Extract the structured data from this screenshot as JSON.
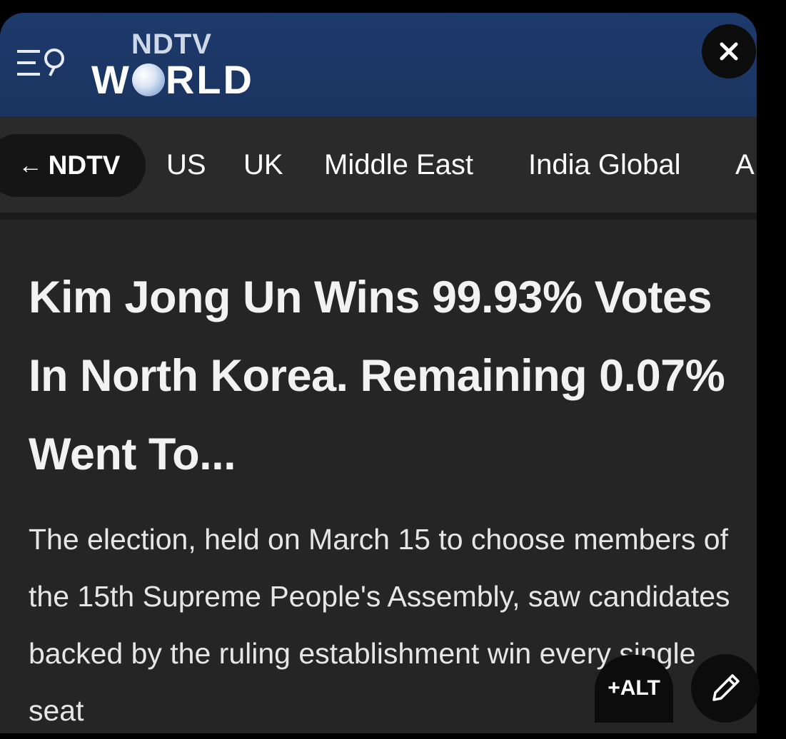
{
  "header": {
    "logo_top": "NDTV",
    "logo_world_pre": "W",
    "logo_world_post": "RLD",
    "brand_color": "#1d3a6c",
    "menu_icon": "menu-search-icon",
    "close_icon": "close-icon"
  },
  "nav": {
    "back_label": "NDTV",
    "items": [
      "US",
      "UK",
      "Middle East",
      "India Global",
      "A"
    ]
  },
  "article": {
    "headline": "Kim Jong Un Wins 99.93% Votes In North Korea. Remaining 0.07% Went To...",
    "body": "The election, held on March 15 to choose members of the 15th Supreme People's Assembly, saw candidates backed by the ruling establishment win every single seat"
  },
  "overlay": {
    "alt_label": "+ALT",
    "edit_icon": "pen-icon"
  }
}
